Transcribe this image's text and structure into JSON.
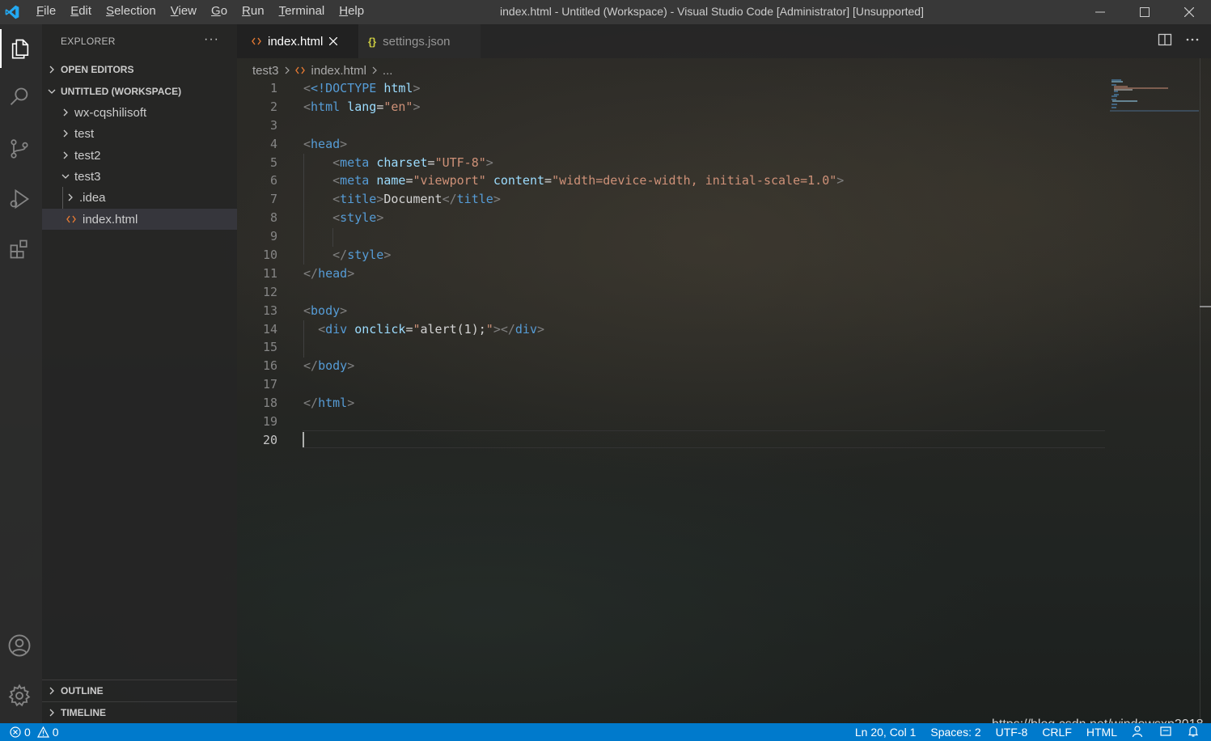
{
  "window": {
    "title": "index.html - Untitled (Workspace) - Visual Studio Code [Administrator] [Unsupported]"
  },
  "menu": [
    {
      "label": "File",
      "ul": "F",
      "rest": "ile"
    },
    {
      "label": "Edit",
      "ul": "E",
      "rest": "dit"
    },
    {
      "label": "Selection",
      "ul": "S",
      "rest": "election"
    },
    {
      "label": "View",
      "ul": "V",
      "rest": "iew"
    },
    {
      "label": "Go",
      "ul": "G",
      "rest": "o"
    },
    {
      "label": "Run",
      "ul": "R",
      "rest": "un"
    },
    {
      "label": "Terminal",
      "ul": "T",
      "rest": "erminal"
    },
    {
      "label": "Help",
      "ul": "H",
      "rest": "elp"
    }
  ],
  "sidebar": {
    "title": "EXPLORER",
    "more": "···",
    "sections": {
      "open_editors": "OPEN EDITORS",
      "workspace": "UNTITLED (WORKSPACE)",
      "outline": "OUTLINE",
      "timeline": "TIMELINE"
    },
    "tree": [
      {
        "label": "wx-cqshilisoft",
        "expanded": false
      },
      {
        "label": "test",
        "expanded": false
      },
      {
        "label": "test2",
        "expanded": false
      },
      {
        "label": "test3",
        "expanded": true
      },
      {
        "label": ".idea",
        "expanded": false
      },
      {
        "label": "index.html",
        "selected": true
      }
    ]
  },
  "tabs": [
    {
      "label": "index.html",
      "active": true,
      "close": "×"
    },
    {
      "label": "settings.json",
      "active": false,
      "icon": "{}"
    }
  ],
  "breadcrumb": {
    "folder": "test3",
    "file": "index.html",
    "more": "..."
  },
  "editor": {
    "line_numbers": [
      "1",
      "2",
      "3",
      "4",
      "5",
      "6",
      "7",
      "8",
      "9",
      "10",
      "11",
      "12",
      "13",
      "14",
      "15",
      "16",
      "17",
      "18",
      "19",
      "20"
    ],
    "tokens": {
      "doctype_open": "<!DOCTYPE",
      "html": "html",
      "lang": "lang",
      "en": "\"en\"",
      "head": "head",
      "meta": "meta",
      "charset": "charset",
      "utf8": "\"UTF-8\"",
      "name": "name",
      "viewport": "\"viewport\"",
      "content": "content",
      "content_val": "\"width=device-width, initial-scale=1.0\"",
      "title": "title",
      "title_text": "Document",
      "style": "style",
      "body": "body",
      "div": "div",
      "onclick": "onclick",
      "onclick_val_q1": "\"",
      "onclick_val": "alert(1);",
      "onclick_val_q2": "\""
    }
  },
  "statusbar": {
    "errors": "0",
    "warnings": "0",
    "position": "Ln 20, Col 1",
    "spaces": "Spaces: 2",
    "encoding": "UTF-8",
    "eol": "CRLF",
    "language": "HTML"
  },
  "watermark": "https://blog.csdn.net/windowsxp2018",
  "colors": {
    "status_bg": "#007acc",
    "tag": "#569cd6",
    "attr": "#9cdcfe",
    "string": "#ce9178",
    "html_icon": "#e37933",
    "json_icon": "#cbcb41"
  }
}
